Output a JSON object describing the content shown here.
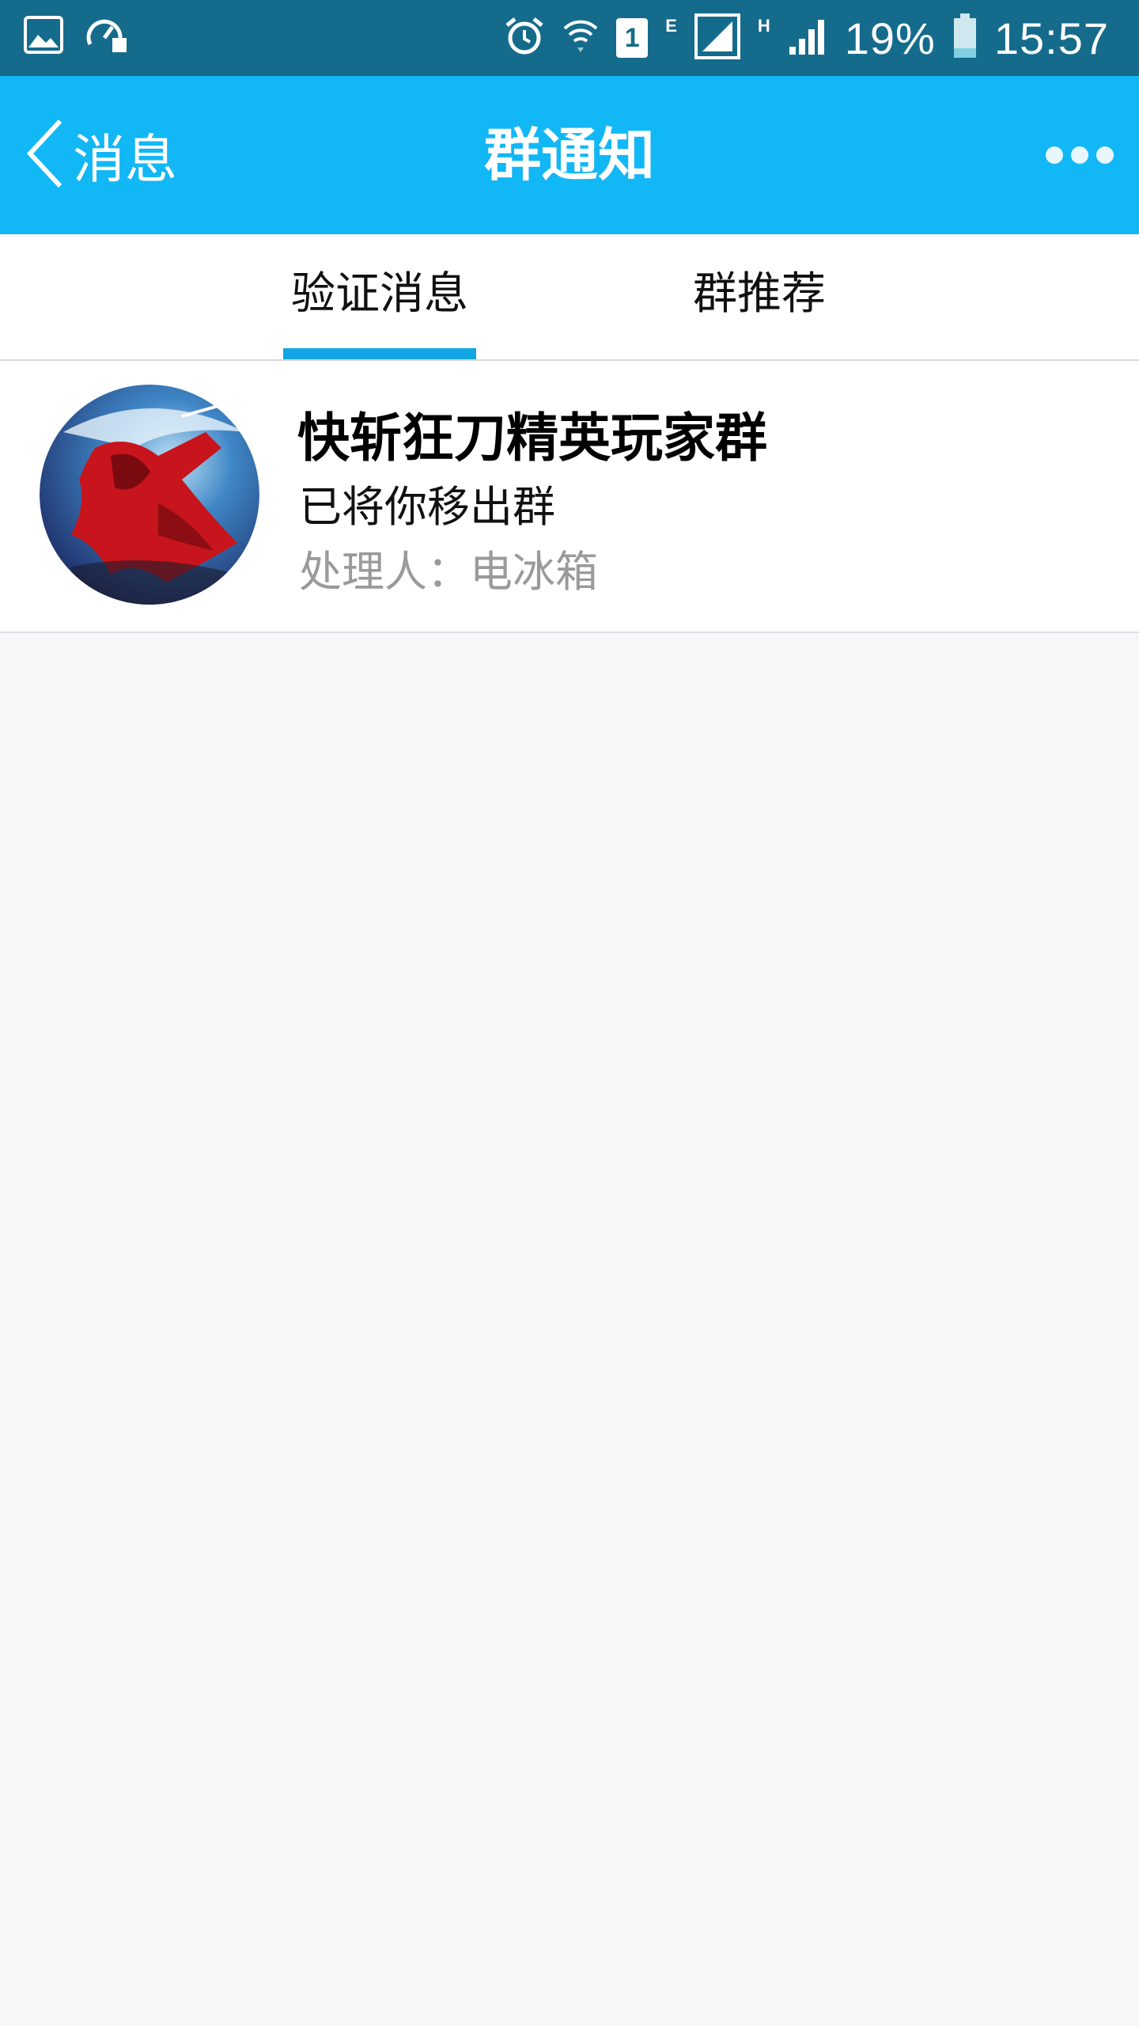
{
  "status_bar": {
    "battery": "19%",
    "time": "15:57",
    "sim_slot": "1",
    "net_type_1": "E",
    "net_type_2": "H",
    "icons": [
      "image-icon",
      "gauge-icon",
      "alarm-icon",
      "wifi-icon",
      "sim-icon",
      "signal-icon",
      "battery-icon"
    ]
  },
  "header": {
    "back_label": "消息",
    "title": "群通知"
  },
  "tabs": [
    {
      "label": "验证消息",
      "active": true
    },
    {
      "label": "群推荐",
      "active": false
    }
  ],
  "notifications": [
    {
      "group_name": "快斩狂刀精英玩家群",
      "message": "已将你移出群",
      "handler": "处理人：电冰箱"
    }
  ],
  "colors": {
    "status_bar": "#156b8c",
    "header": "#12b7f5",
    "tab_indicator": "#12a6e4",
    "background": "#f7f7f9"
  }
}
